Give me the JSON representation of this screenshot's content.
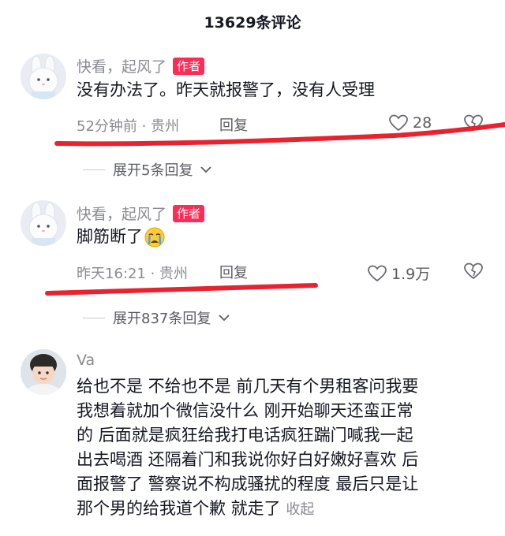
{
  "header": {
    "title": "13629条评论"
  },
  "comments": [
    {
      "username": "快看，起风了",
      "badge": "作者",
      "text": "没有办法了。昨天就报警了，没有人受理",
      "meta": "52分钟前 · 贵州",
      "reply_label": "回复",
      "likes": "28",
      "expand_label": "展开5条回复"
    },
    {
      "username": "快看，起风了",
      "badge": "作者",
      "text": "脚筋断了",
      "emoji": "crying-face-icon",
      "meta": "昨天16:21 · 贵州",
      "reply_label": "回复",
      "likes": "1.9万",
      "expand_label": "展开837条回复"
    },
    {
      "username": "Va",
      "text_lines": [
        "给也不是 不给也不是 前几天有个男租客问我要",
        "我想着就加个微信没什么 刚开始聊天还蛮正常",
        "的 后面就是疯狂给我打电话疯狂踹门喊我一起",
        "出去喝酒 还隔着门和我说你好白好嫩好喜欢 后",
        "面报警了 警察说不构成骚扰的程度 最后只是让",
        "那个男的给我道个歉 就走了"
      ],
      "collapse_label": "收起"
    }
  ],
  "colors": {
    "author_badge": "#fe2c55",
    "annotation_red": "#e8232f",
    "secondary_text": "#8a8b91"
  },
  "icons": [
    "heart-outline-icon",
    "dislike-heart-icon",
    "chevron-down-icon",
    "crying-face-icon"
  ]
}
